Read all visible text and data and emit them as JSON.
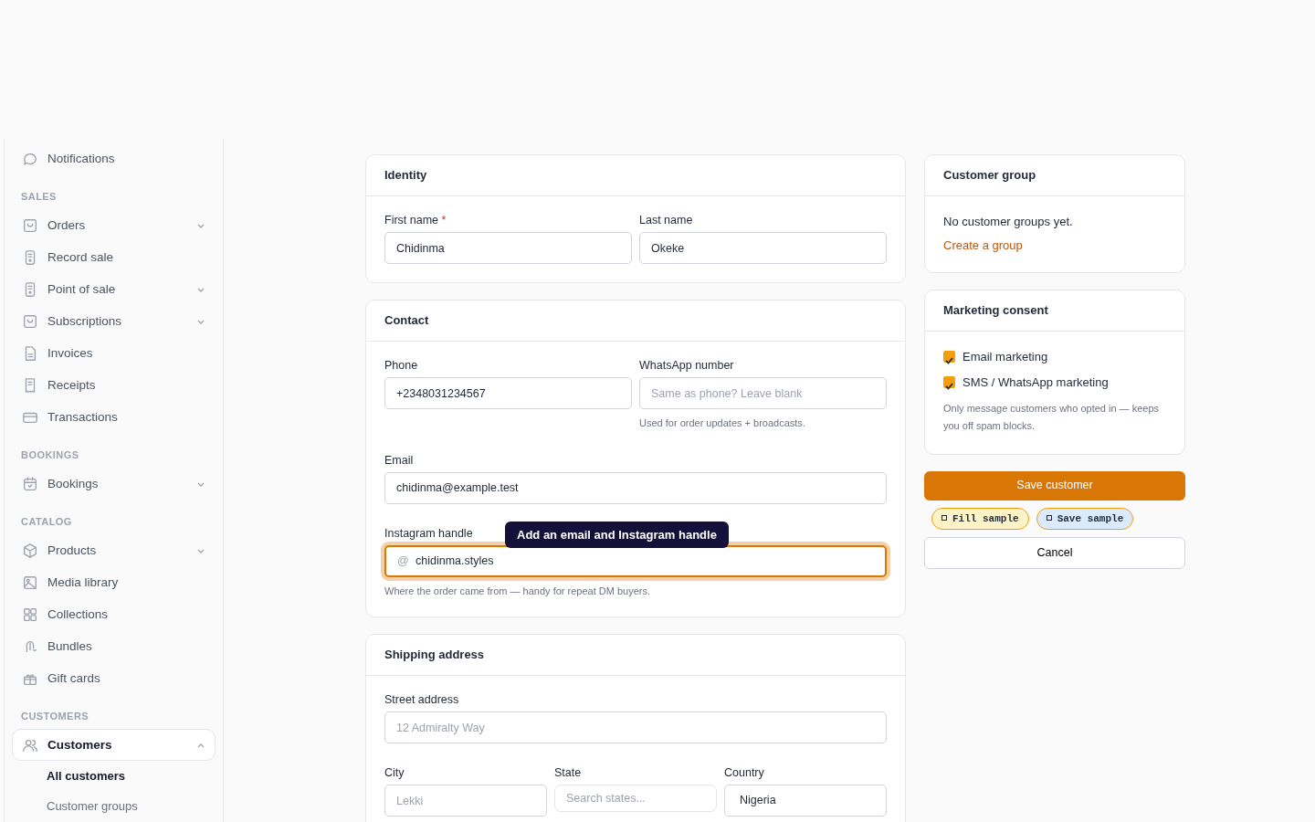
{
  "sidebar": {
    "sections": [
      {
        "items": [
          {
            "label": "Notifications",
            "selected": false
          }
        ]
      },
      {
        "heading": "SALES",
        "items": [
          {
            "label": "Orders",
            "selected": false,
            "expanded": false
          },
          {
            "label": "Record sale",
            "selected": false
          },
          {
            "label": "Point of sale",
            "selected": false,
            "expanded": false
          },
          {
            "label": "Subscriptions",
            "selected": false,
            "expanded": false
          },
          {
            "label": "Invoices",
            "selected": false
          },
          {
            "label": "Receipts",
            "selected": false
          },
          {
            "label": "Transactions",
            "selected": false
          }
        ]
      },
      {
        "heading": "BOOKINGS",
        "items": [
          {
            "label": "Bookings",
            "selected": false,
            "expanded": false
          }
        ]
      },
      {
        "heading": "CATALOG",
        "items": [
          {
            "label": "Products",
            "selected": false,
            "expanded": false
          },
          {
            "label": "Media library",
            "selected": false
          },
          {
            "label": "Collections",
            "selected": false
          },
          {
            "label": "Bundles",
            "selected": false
          },
          {
            "label": "Gift cards",
            "selected": false
          }
        ]
      },
      {
        "heading": "CUSTOMERS",
        "items": [
          {
            "label": "Customers",
            "selected": true,
            "expanded": true,
            "children": [
              {
                "label": "All customers",
                "selected": true
              },
              {
                "label": "Customer groups",
                "selected": false
              }
            ]
          }
        ]
      }
    ]
  },
  "cards": [
    {
      "title": "Identity",
      "rows": [
        [
          {
            "label": "First name",
            "required_mark": "*",
            "value": "Chidinma"
          },
          {
            "label": "Last name",
            "value": "Okeke"
          }
        ]
      ]
    },
    {
      "title": "Contact",
      "rows": [
        [
          {
            "label": "Phone",
            "value": "+2348031234567"
          },
          {
            "label": "WhatsApp number",
            "placeholder": "Same as phone? Leave blank",
            "help": "Used for order updates + broadcasts."
          }
        ],
        [
          {
            "label": "Email",
            "value": "chidinma@example.test"
          }
        ],
        [
          {
            "label": "Instagram handle",
            "prefix": "@",
            "value": "chidinma.styles",
            "focused": true,
            "tooltip": "Add an email and Instagram handle",
            "help": "Where the order came from — handy for repeat DM buyers."
          }
        ]
      ]
    },
    {
      "title": "Shipping address",
      "rows": [
        [
          {
            "label": "Street address",
            "placeholder": "12 Admiralty Way"
          }
        ],
        [
          {
            "label": "City",
            "placeholder": "Lekki"
          },
          {
            "label": "State",
            "kind": "search",
            "placeholder": "Search states..."
          },
          {
            "label": "Country",
            "kind": "select",
            "value": "Nigeria"
          }
        ]
      ]
    }
  ],
  "customer_group": {
    "title": "Customer group",
    "text": "No customer groups yet.",
    "link": "Create a group"
  },
  "marketing": {
    "title": "Marketing consent",
    "options": [
      {
        "label": "Email marketing",
        "checked": true
      },
      {
        "label": "SMS / WhatsApp marketing",
        "checked": true
      }
    ],
    "note": "Only message customers who opted in — keeps you off spam blocks."
  },
  "save_button": "Save customer",
  "sample_buttons": [
    {
      "label": "Fill sample",
      "color": "#fef3c7"
    },
    {
      "label": "Save sample",
      "color": "#dbeafe"
    }
  ],
  "cancel_button": "Cancel"
}
